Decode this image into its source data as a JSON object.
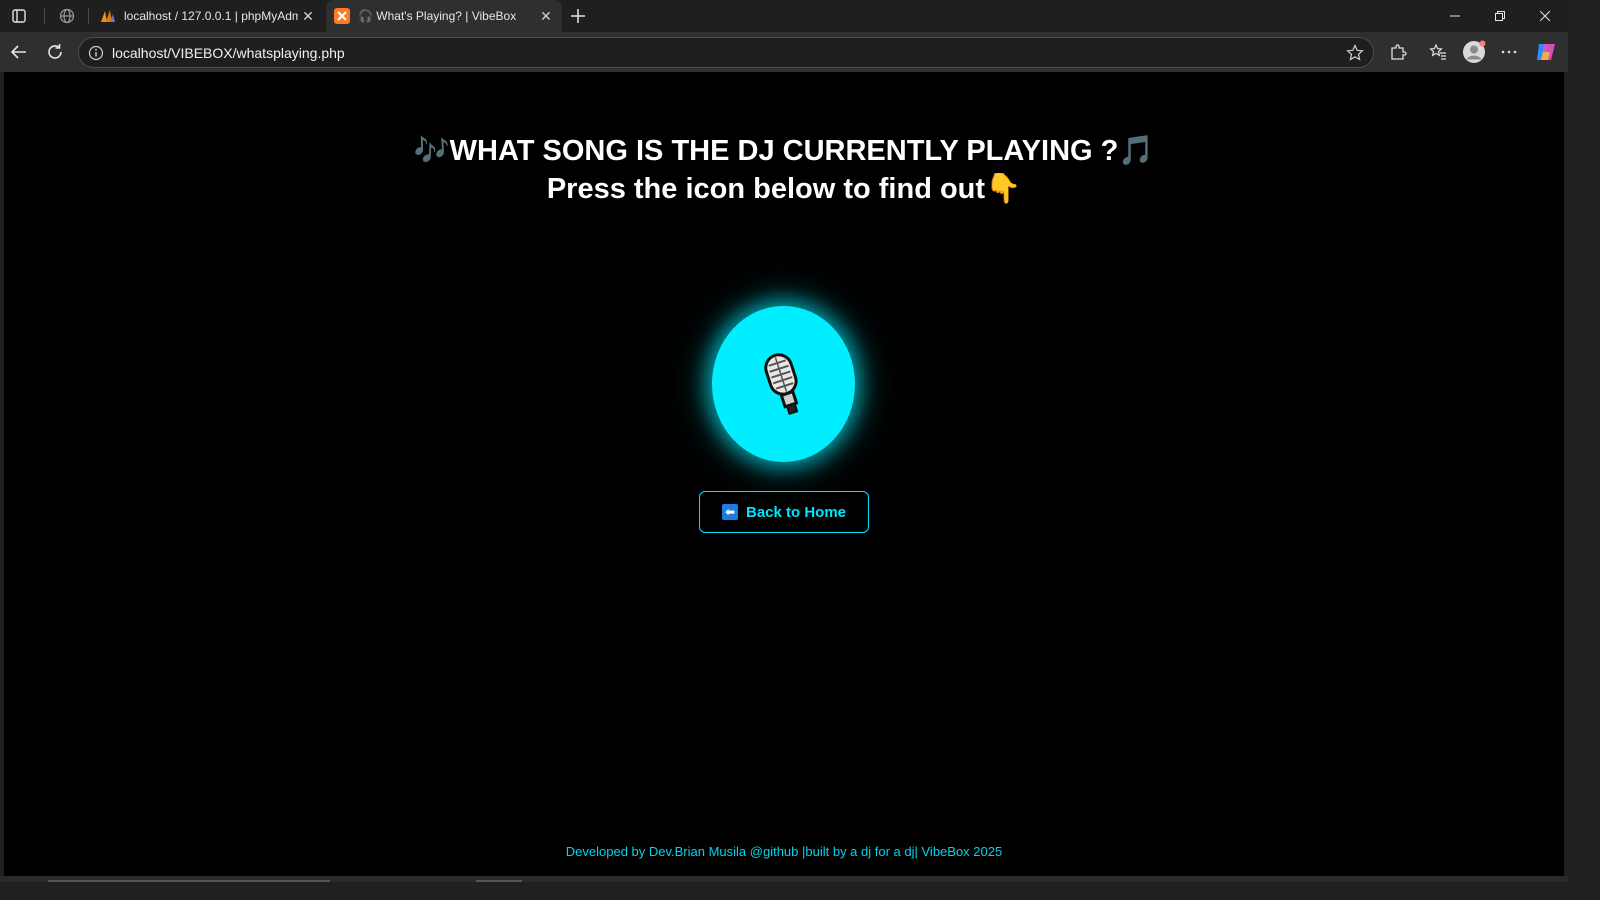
{
  "browser": {
    "tabs": [
      {
        "title": "localhost / 127.0.0.1 | phpMyAdm",
        "active": false
      },
      {
        "title": "🎧 What's Playing? | VibeBox",
        "active": true
      }
    ],
    "address_bar": {
      "url": "localhost/VIBEBOX/whatsplaying.php"
    }
  },
  "page": {
    "heading_line1": "WHAT SONG IS THE DJ CURRENTLY PLAYING ?",
    "heading_line1_lead_emoji": "🎶",
    "heading_line1_trail_emoji": "🎵",
    "heading_line2": "Press the icon below to find out",
    "heading_line2_emoji": "👇",
    "mic_button": {
      "icon": "microphone-icon",
      "color": "#00eeff"
    },
    "back_button": {
      "icon": "left-arrow-icon",
      "label": "Back to Home"
    },
    "footer": "Developed by Dev.Brian Musila @github |built by a dj for a dj| VibeBox 2025",
    "colors": {
      "background": "#000000",
      "accent": "#00e5ff",
      "heading": "#ffffff"
    }
  }
}
